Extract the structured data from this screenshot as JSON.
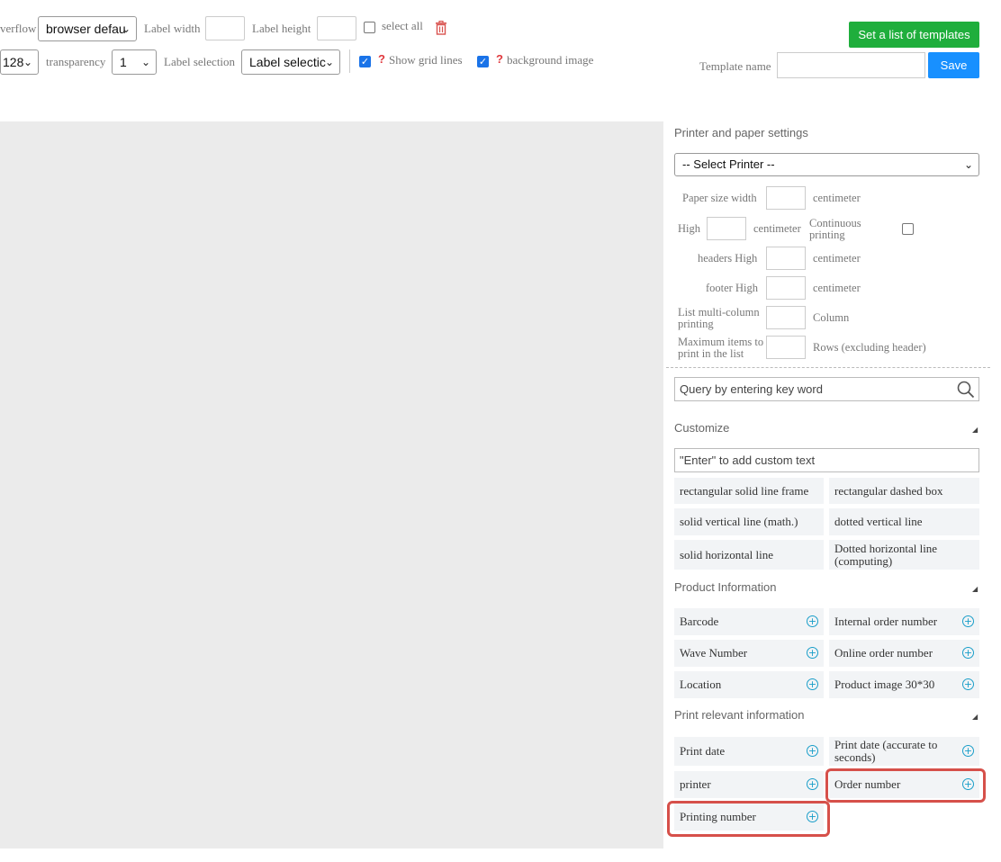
{
  "toolbar": {
    "overflow_label": "verflow",
    "overflow_value": "browser defau",
    "label_width_label": "Label width",
    "label_height_label": "Label height",
    "select_all_label": "select all",
    "font_size_value": "128",
    "transparency_label": "transparency",
    "transparency_value": "1",
    "label_selection_label": "Label selection",
    "label_selection_value": "Label selectic",
    "show_grid_lines_label": "Show grid lines",
    "show_grid_lines_checked": true,
    "background_image_label": "background image",
    "background_image_checked": true,
    "set_templates_button": "Set a list of templates",
    "template_name_label": "Template name",
    "save_button": "Save"
  },
  "panel": {
    "printer_section_title": "Printer and paper settings",
    "printer_select_value": "-- Select Printer --",
    "paper_width_label": "Paper size width",
    "high_label": "High",
    "continuous_label": "Continuous printing",
    "headers_high_label": "headers High",
    "footer_high_label": "footer High",
    "multi_column_label": "List multi-column printing",
    "max_items_label": "Maximum items to print in the list",
    "unit_centimeter": "centimeter",
    "unit_column": "Column",
    "unit_rows": "Rows (excluding header)",
    "search_placeholder": "Query by entering key word",
    "customize_title": "Customize",
    "custom_text_placeholder": "\"Enter\"  to add custom text",
    "customize_items": [
      "rectangular solid line frame",
      "rectangular dashed box",
      "solid vertical line (math.)",
      "dotted vertical line",
      "solid horizontal line",
      "Dotted horizontal line (computing)"
    ],
    "product_title": "Product Information",
    "product_items": [
      "Barcode",
      "Internal order number",
      "Wave Number",
      "Online order number",
      "Location",
      "Product image 30*30"
    ],
    "print_title": "Print relevant information",
    "print_items": [
      "Print date",
      "Print date (accurate to seconds)",
      "printer",
      "Order number",
      "Printing number"
    ]
  },
  "colors": {
    "green_button": "#1fae3c",
    "blue_button": "#1890ff",
    "highlight": "#d6504a",
    "canvas": "#ebebeb"
  }
}
